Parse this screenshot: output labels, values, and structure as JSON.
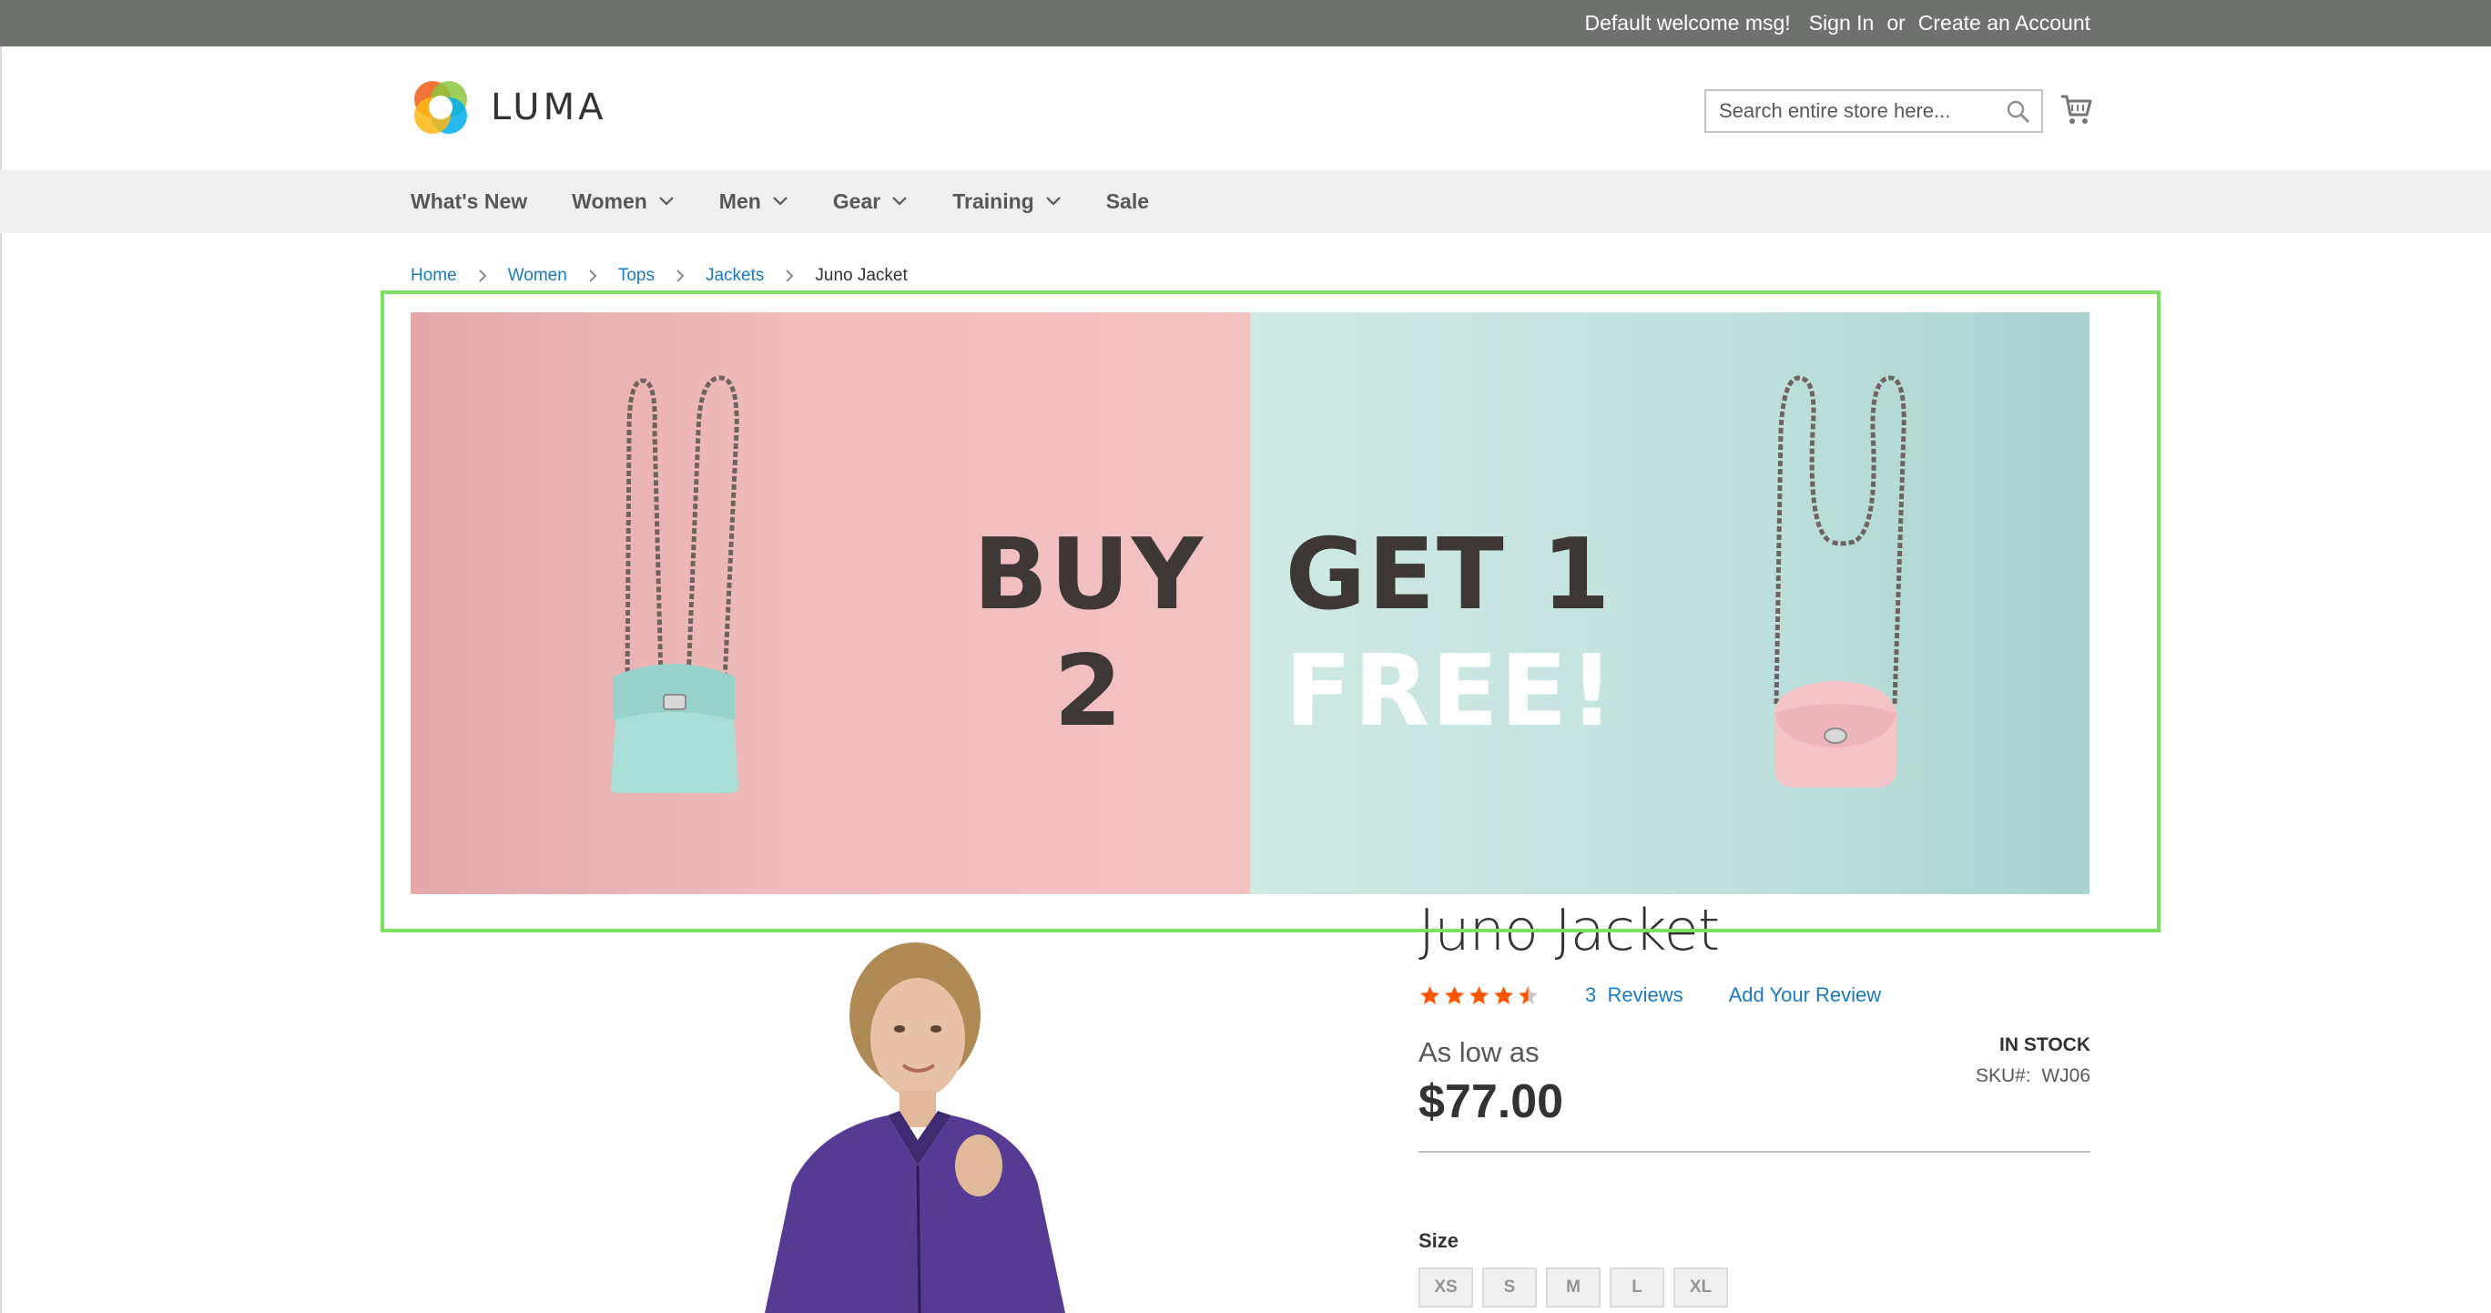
{
  "header": {
    "welcome": "Default welcome msg!",
    "sign_in": "Sign In",
    "or": "or",
    "create_account": "Create an Account"
  },
  "logo": {
    "text": "LUMA"
  },
  "search": {
    "placeholder": "Search entire store here..."
  },
  "nav": {
    "items": [
      {
        "label": "What's New",
        "has_dropdown": false
      },
      {
        "label": "Women",
        "has_dropdown": true
      },
      {
        "label": "Men",
        "has_dropdown": true
      },
      {
        "label": "Gear",
        "has_dropdown": true
      },
      {
        "label": "Training",
        "has_dropdown": true
      },
      {
        "label": "Sale",
        "has_dropdown": false
      }
    ]
  },
  "breadcrumbs": {
    "items": [
      "Home",
      "Women",
      "Tops",
      "Jackets"
    ],
    "current": "Juno Jacket"
  },
  "banner": {
    "line1_left": "BUY",
    "line2_left": "2",
    "line1_right": "GET 1",
    "line2_right": "FREE!",
    "colors": {
      "pink": "#f0bcbc",
      "mint": "#c2e2de",
      "frame": "#7ce160"
    }
  },
  "product": {
    "title": "Juno Jacket",
    "rating_stars": 4.5,
    "reviews_count": "3",
    "reviews_label": "Reviews",
    "add_review": "Add Your Review",
    "price_label": "As low as",
    "price": "$77.00",
    "stock": "IN STOCK",
    "sku_label": "SKU#:",
    "sku_value": "WJ06",
    "size_label": "Size",
    "sizes": [
      "XS",
      "S",
      "M",
      "L",
      "XL"
    ]
  },
  "icons": {
    "search": "search-icon",
    "cart": "cart-icon",
    "chevron": "chevron-down-icon",
    "breadcrumb_separator": "chevron-right-icon",
    "star": "star-icon"
  }
}
